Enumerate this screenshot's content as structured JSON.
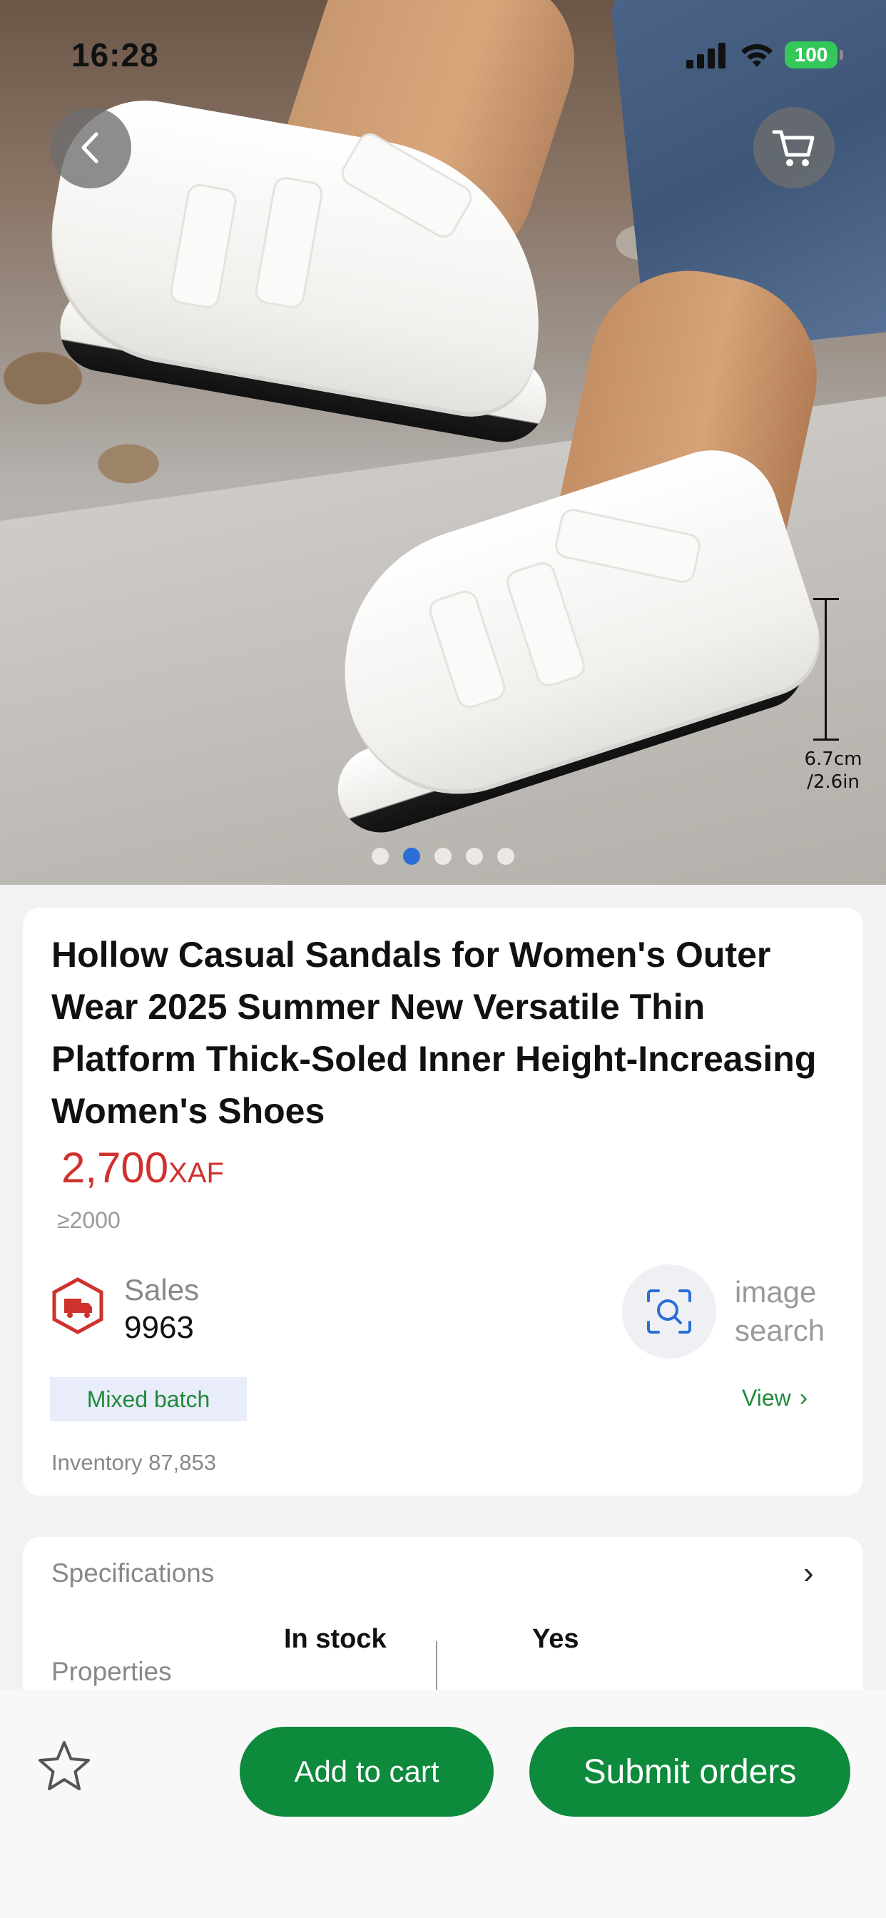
{
  "status_bar": {
    "time": "16:28",
    "battery": "100"
  },
  "hero": {
    "measure": "6.7cm\n/2.6in",
    "carousel_count": 5,
    "carousel_active_index": 1
  },
  "product": {
    "title": "Hollow Casual Sandals for Women's Outer Wear 2025 Summer New Versatile Thin Platform Thick-Soled Inner Height-Increasing Women's Shoes",
    "price_amount": "2,700",
    "price_currency": "XAF",
    "moq": "≥2000",
    "sales_label": "Sales",
    "sales_value": "9963",
    "image_search_label": "image\nsearch",
    "batch_badge": "Mixed batch",
    "view_link": "View",
    "inventory": "Inventory 87,853"
  },
  "specs": {
    "label": "Specifications",
    "properties_label": "Properties",
    "col1": "In stock",
    "col2": "Yes"
  },
  "bottom_bar": {
    "add_to_cart": "Add to cart",
    "submit_orders": "Submit orders"
  },
  "colors": {
    "price_red": "#d0312d",
    "brand_green": "#0d8a3c",
    "carousel_active": "#2b6fd6",
    "battery_green": "#34c759"
  }
}
